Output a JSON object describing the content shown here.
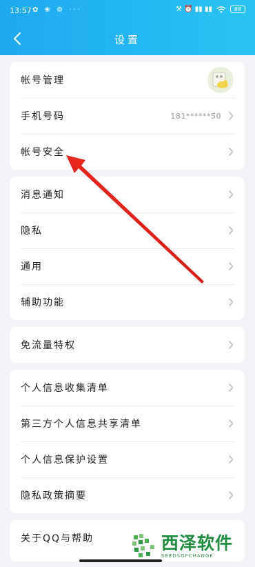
{
  "status_bar": {
    "time": "13:57",
    "left_icons": "✿ ❀ ⚙ ···",
    "right_icons": "⚒ ⏰ ▮▮ ▮▮",
    "battery": "88"
  },
  "header": {
    "title": "设置",
    "back_icon": "chevron-left-icon"
  },
  "cards": {
    "account": {
      "rows": [
        {
          "label": "帐号管理",
          "value": ""
        },
        {
          "label": "手机号码",
          "value": "181******50"
        },
        {
          "label": "帐号安全",
          "value": ""
        }
      ]
    },
    "general": {
      "rows": [
        {
          "label": "消息通知"
        },
        {
          "label": "隐私"
        },
        {
          "label": "通用"
        },
        {
          "label": "辅助功能"
        }
      ]
    },
    "traffic": {
      "rows": [
        {
          "label": "免流量特权"
        }
      ]
    },
    "privacy": {
      "rows": [
        {
          "label": "个人信息收集清单"
        },
        {
          "label": "第三方个人信息共享清单"
        },
        {
          "label": "个人信息保护设置"
        },
        {
          "label": "隐私政策摘要"
        }
      ]
    },
    "about": {
      "rows": [
        {
          "label": "关于QQ与帮助"
        }
      ]
    }
  },
  "annotation": {
    "arrow_color": "#e8261c"
  },
  "watermark": {
    "title": "西泽软件",
    "subtitle": "SEEDSOFCHANGE"
  },
  "colors": {
    "header_start": "#1ea9f0",
    "header_end": "#29c4f3",
    "background": "#f2f3f7"
  }
}
